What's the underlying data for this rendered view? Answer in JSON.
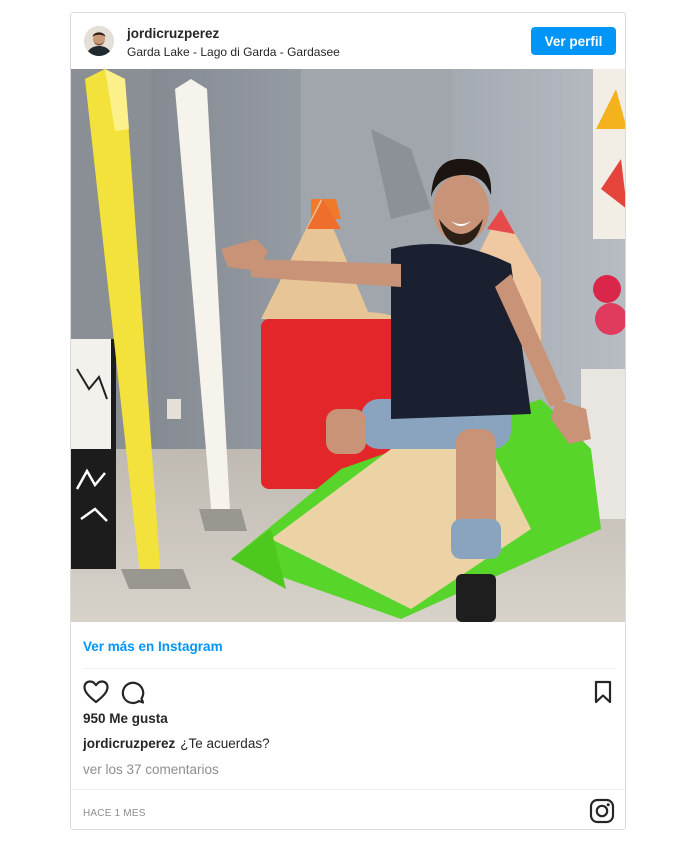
{
  "header": {
    "username": "jordicruzperez",
    "location": "Garda Lake - Lago di Garda - Gardasee",
    "profile_button": "Ver perfil"
  },
  "post": {
    "view_more": "Ver más en Instagram",
    "likes": "950 Me gusta",
    "caption_user": "jordicruzperez",
    "caption_text": "¿Te acuerdas?",
    "comments_link": "ver los 37 comentarios",
    "time": "HACE 1 MES"
  },
  "icons": {
    "like": "heart-icon",
    "comment": "comment-icon",
    "save": "bookmark-icon",
    "logo": "instagram-icon"
  },
  "colors": {
    "accent": "#0095f6",
    "text": "#262626",
    "muted": "#8e8e8e",
    "border": "#dbdbdb"
  }
}
